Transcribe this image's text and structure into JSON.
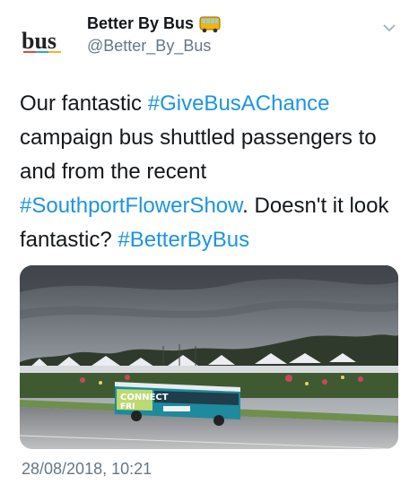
{
  "account": {
    "display_name": "Better By Bus",
    "handle": "@Better_By_Bus",
    "avatar_text": "bus",
    "badge_icon": "bus-emoji-icon"
  },
  "tweet": {
    "t1": "Our fantastic ",
    "tag1": "#GiveBusAChance",
    "t2": " campaign bus shuttled passengers to and from the recent ",
    "tag2": "#SouthportFlowerShow",
    "t3": ". Doesn't it look fantastic? ",
    "tag3": "#BetterByBus"
  },
  "media": {
    "bus_side_text": "CONNECT",
    "bus_side_text2": "FRI"
  },
  "timestamp": "28/08/2018, 10:21",
  "colors": {
    "link": "#1b95e0",
    "secondary": "#657786",
    "bus_livery": "#1d8a9e"
  }
}
